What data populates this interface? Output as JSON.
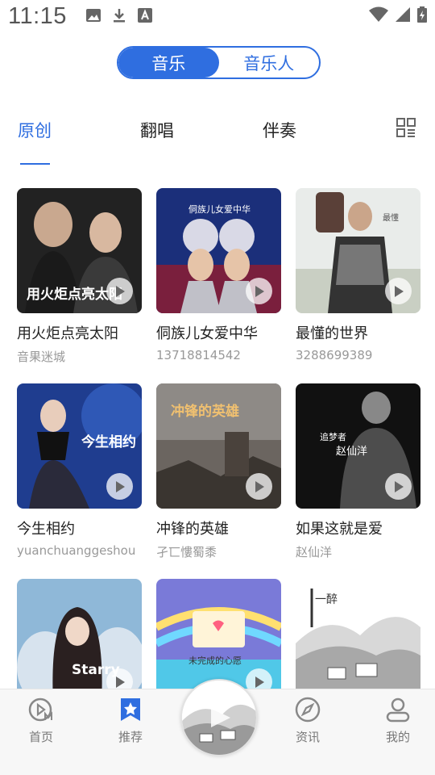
{
  "status_bar": {
    "time": "11:15"
  },
  "segmented": {
    "music": "音乐",
    "musician": "音乐人"
  },
  "tabs": {
    "original": "原创",
    "cover": "翻唱",
    "accompaniment": "伴奏"
  },
  "songs": [
    {
      "title": "用火炬点亮太阳",
      "artist": "音果迷城"
    },
    {
      "title": "侗族儿女爱中华",
      "artist": "13718814542"
    },
    {
      "title": "最懂的世界",
      "artist": "3288699389"
    },
    {
      "title": "今生相约",
      "artist": "yuanchuanggeshou"
    },
    {
      "title": "冲锋的英雄",
      "artist": "孑匸慺蜀黍"
    },
    {
      "title": "如果这就是爱",
      "artist": "赵仙洋"
    },
    {
      "title": "",
      "artist": ""
    },
    {
      "title": "",
      "artist": ""
    },
    {
      "title": "",
      "artist": ""
    }
  ],
  "cover_text": {
    "c1": "用火炬点亮太阳",
    "c2": "侗族儿女爱中华",
    "c4": "今生相约",
    "c5": "冲锋的英雄",
    "c6": "赵仙洋",
    "c7": "Starry",
    "c8": "未完成的心愿"
  },
  "bottom_nav": {
    "home": "首页",
    "recommend": "推荐",
    "news": "资讯",
    "mine": "我的"
  },
  "colors": {
    "accent": "#2f6ee0"
  }
}
